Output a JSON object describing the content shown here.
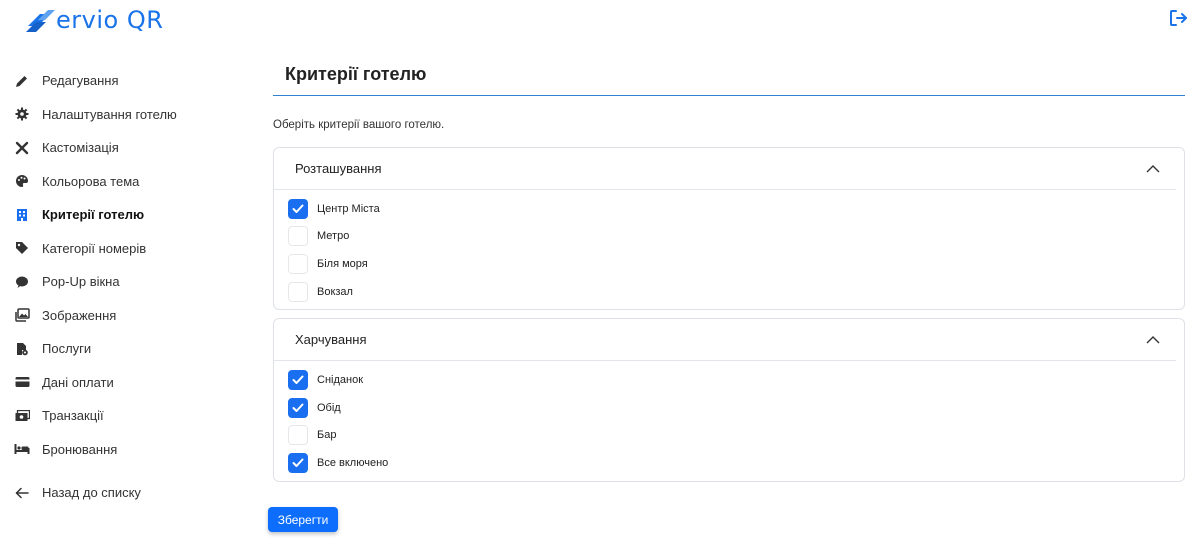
{
  "app": {
    "logo_text": "ervio QR",
    "brand_color": "#1a73e8",
    "accent_color": "#0d6efd"
  },
  "header": {
    "logout_icon": "logout-icon"
  },
  "sidebar": {
    "items": [
      {
        "label": "Редагування",
        "icon": "pencil-icon",
        "active": false
      },
      {
        "label": "Налаштування готелю",
        "icon": "gear-icon",
        "active": false
      },
      {
        "label": "Кастомізація",
        "icon": "tools-icon",
        "active": false
      },
      {
        "label": "Кольорова тема",
        "icon": "palette-icon",
        "active": false
      },
      {
        "label": "Критерії готелю",
        "icon": "building-icon",
        "active": true
      },
      {
        "label": "Категорії номерів",
        "icon": "tag-icon",
        "active": false
      },
      {
        "label": "Pop-Up вікна",
        "icon": "chat-icon",
        "active": false
      },
      {
        "label": "Зображення",
        "icon": "images-icon",
        "active": false
      },
      {
        "label": "Послуги",
        "icon": "file-gear-icon",
        "active": false
      },
      {
        "label": "Дані оплати",
        "icon": "credit-card-icon",
        "active": false
      },
      {
        "label": "Транзакції",
        "icon": "cash-icon",
        "active": false
      },
      {
        "label": "Бронювання",
        "icon": "bed-icon",
        "active": false
      }
    ],
    "back": {
      "label": "Назад до списку",
      "icon": "arrow-left-icon"
    }
  },
  "main": {
    "title": "Критерії готелю",
    "subtitle": "Оберіть критерії вашого готелю.",
    "sections": [
      {
        "title": "Розташування",
        "expanded": true,
        "options": [
          {
            "label": "Центр Міста",
            "checked": true
          },
          {
            "label": "Метро",
            "checked": false
          },
          {
            "label": "Біля моря",
            "checked": false
          },
          {
            "label": "Вокзал",
            "checked": false
          }
        ]
      },
      {
        "title": "Харчування",
        "expanded": true,
        "options": [
          {
            "label": "Сніданок",
            "checked": true
          },
          {
            "label": "Обід",
            "checked": true
          },
          {
            "label": "Бар",
            "checked": false
          },
          {
            "label": "Все включено",
            "checked": true
          }
        ]
      }
    ],
    "save_label": "Зберегти"
  }
}
